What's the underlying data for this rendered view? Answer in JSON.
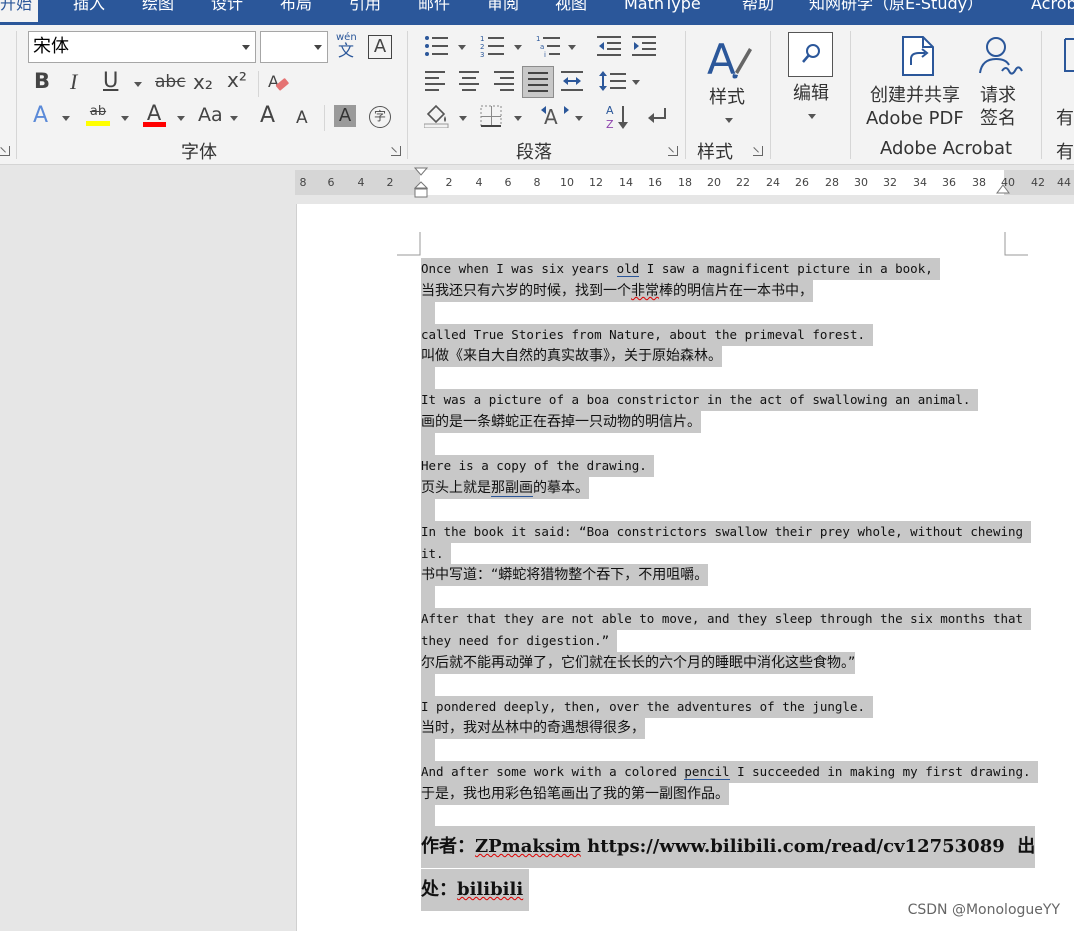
{
  "tabs": {
    "home": "开始",
    "insert": "插入",
    "draw": "绘图",
    "design": "设计",
    "layout": "布局",
    "references": "引用",
    "mailings": "邮件",
    "review": "审阅",
    "view": "视图",
    "mathtype": "MathType",
    "help": "帮助",
    "cnki": "知网研学（原E-Study）",
    "acrobat": "Acrob"
  },
  "font_group": {
    "font_name": "宋体",
    "font_size": "",
    "wen_label": "wén",
    "wen_char": "文",
    "char_border": "A",
    "bold": "B",
    "italic": "I",
    "underline": "U",
    "strike": "abc",
    "subscript": "x₂",
    "superscript": "x²",
    "text_effect": "A",
    "highlight": "ab",
    "font_color": "A",
    "change_case": "Aa",
    "grow": "A",
    "shrink": "A",
    "char_shading": "A",
    "enclose": "字",
    "label": "字体",
    "highlight_color": "#ffff00",
    "font_color_value": "#ff0000"
  },
  "paragraph_group": {
    "label": "段落"
  },
  "styles_group": {
    "button_label": "样式",
    "label": "样式"
  },
  "editing": {
    "label": "编辑"
  },
  "acrobat_group": {
    "create_line1": "创建并共享",
    "create_line2": "Adobe PDF",
    "sign_line1": "请求",
    "sign_line2": "签名",
    "label": "Adobe Acrobat",
    "cut1": "有",
    "cut2": "有"
  },
  "ruler": {
    "numbers_left": [
      "8",
      "6",
      "4",
      "2"
    ],
    "numbers_right": [
      "2",
      "4",
      "6",
      "8",
      "10",
      "12",
      "14",
      "16",
      "18",
      "20",
      "22",
      "24",
      "26",
      "28",
      "30",
      "32",
      "34",
      "36",
      "38",
      "40",
      "42",
      "44"
    ]
  },
  "document": {
    "p1_en_a": "Once when I was six years ",
    "p1_en_u": "old",
    "p1_en_b": " I saw a magnificent picture in a book, ",
    "p1_zh_a": "当我还只有六岁的时候，找到一个",
    "p1_zh_u": "非常",
    "p1_zh_b": "棒的明信片在一本书中，",
    "p2_en": "called True Stories from Nature, about the primeval forest. ",
    "p2_zh": "叫做《来自大自然的真实故事》，关于原始森林。",
    "p3_en": "It was a picture of a boa constrictor in the act of swallowing an animal. ",
    "p3_zh": "画的是一条蟒蛇正在吞掉一只动物的明信片。",
    "p4_en": "Here is a copy of the drawing. ",
    "p4_zh_a": "页头上就是",
    "p4_zh_u": "那副画",
    "p4_zh_b": "的摹本。",
    "p5_en_1": "In the book it said: “Boa constrictors swallow their prey whole, without chewing ",
    "p5_en_2": "it. ",
    "p5_zh": "书中写道：“蟒蛇将猎物整个吞下，不用咀嚼。",
    "p6_en_1": "After that they are not able to move, and they sleep through the six months that ",
    "p6_en_2": "they need for digestion.” ",
    "p6_zh": "尔后就不能再动弹了，它们就在长长的六个月的睡眠中消化这些食物。”",
    "p7_en": "I pondered deeply, then, over the adventures of the jungle. ",
    "p7_zh": "当时，我对丛林中的奇遇想得很多，",
    "p8_en_a": "And after some work with a colored ",
    "p8_en_u": "pencil",
    "p8_en_b": " I succeeded in making my first drawing. ",
    "p8_zh": "于是，我也用彩色铅笔画出了我的第一副图作品。",
    "author_a": "作者：",
    "author_u": "ZPmaksim",
    "author_b": " https://www.bilibili.com/read/cv12753089  出",
    "source_a": "处：",
    "source_u": "bilibili",
    "source_b": " "
  },
  "watermark": "CSDN @MonologueYY"
}
